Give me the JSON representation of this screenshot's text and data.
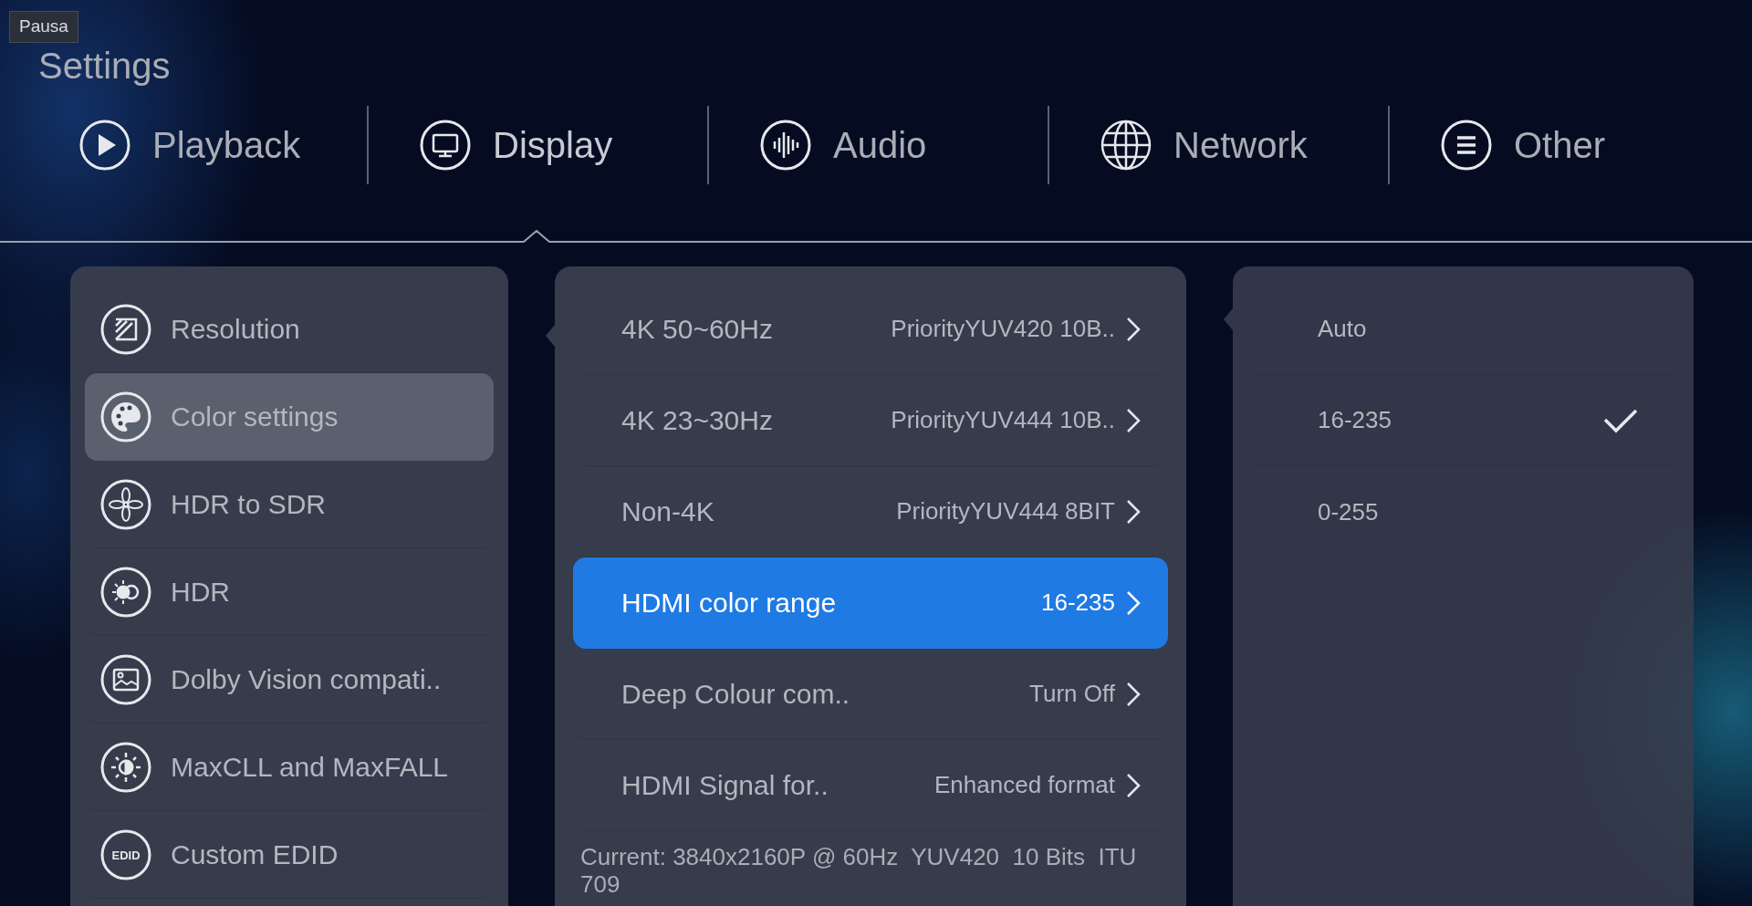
{
  "tooltip": "Pausa",
  "title": "Settings",
  "tabs": [
    {
      "label": "Playback",
      "selected": false
    },
    {
      "label": "Display",
      "selected": true
    },
    {
      "label": "Audio",
      "selected": false
    },
    {
      "label": "Network",
      "selected": false
    },
    {
      "label": "Other",
      "selected": false
    }
  ],
  "categories": [
    {
      "label": "Resolution",
      "selected": false
    },
    {
      "label": "Color settings",
      "selected": true
    },
    {
      "label": "HDR to SDR",
      "selected": false
    },
    {
      "label": "HDR",
      "selected": false
    },
    {
      "label": "Dolby Vision compati..",
      "selected": false
    },
    {
      "label": "MaxCLL and MaxFALL",
      "selected": false
    },
    {
      "label": "Custom EDID",
      "selected": false,
      "icon_text": "EDID"
    }
  ],
  "options": [
    {
      "label": "4K 50~60Hz",
      "value": "PriorityYUV420 10B..",
      "selected": false
    },
    {
      "label": "4K 23~30Hz",
      "value": "PriorityYUV444 10B..",
      "selected": false
    },
    {
      "label": "Non-4K",
      "value": "PriorityYUV444 8BIT",
      "selected": false
    },
    {
      "label": "HDMI color range",
      "value": "16-235",
      "selected": true
    },
    {
      "label": "Deep Colour com..",
      "value": "Turn Off",
      "selected": false
    },
    {
      "label": "HDMI Signal for..",
      "value": "Enhanced format",
      "selected": false
    }
  ],
  "current_info": "Current: 3840x2160P @ 60Hz  YUV420  10 Bits  ITU 709",
  "choices": [
    {
      "label": "Auto",
      "checked": false
    },
    {
      "label": "16-235",
      "checked": true
    },
    {
      "label": "0-255",
      "checked": false
    }
  ]
}
